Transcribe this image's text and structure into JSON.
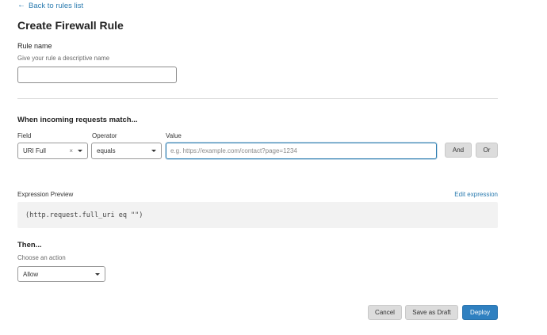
{
  "nav": {
    "back_label": "Back to rules list"
  },
  "page": {
    "title": "Create Firewall Rule"
  },
  "rule_name": {
    "label": "Rule name",
    "helper": "Give your rule a descriptive name",
    "value": "",
    "placeholder": ""
  },
  "match": {
    "heading": "When incoming requests match...",
    "field_label": "Field",
    "field_value": "URI Full",
    "field_clear_icon": "×",
    "operator_label": "Operator",
    "operator_value": "equals",
    "value_label": "Value",
    "value_placeholder": "e.g. https://example.com/contact?page=1234",
    "and_label": "And",
    "or_label": "Or"
  },
  "expression": {
    "label": "Expression Preview",
    "edit_label": "Edit expression",
    "code": "(http.request.full_uri eq \"\")"
  },
  "then": {
    "heading": "Then...",
    "helper": "Choose an action",
    "action_value": "Allow"
  },
  "footer": {
    "cancel_label": "Cancel",
    "draft_label": "Save as Draft",
    "deploy_label": "Deploy"
  },
  "colors": {
    "accent": "#2c7cb0",
    "primary_button": "#2f80c0",
    "secondary_button": "#dcdcdc",
    "preview_bg": "#f2f2f2"
  }
}
